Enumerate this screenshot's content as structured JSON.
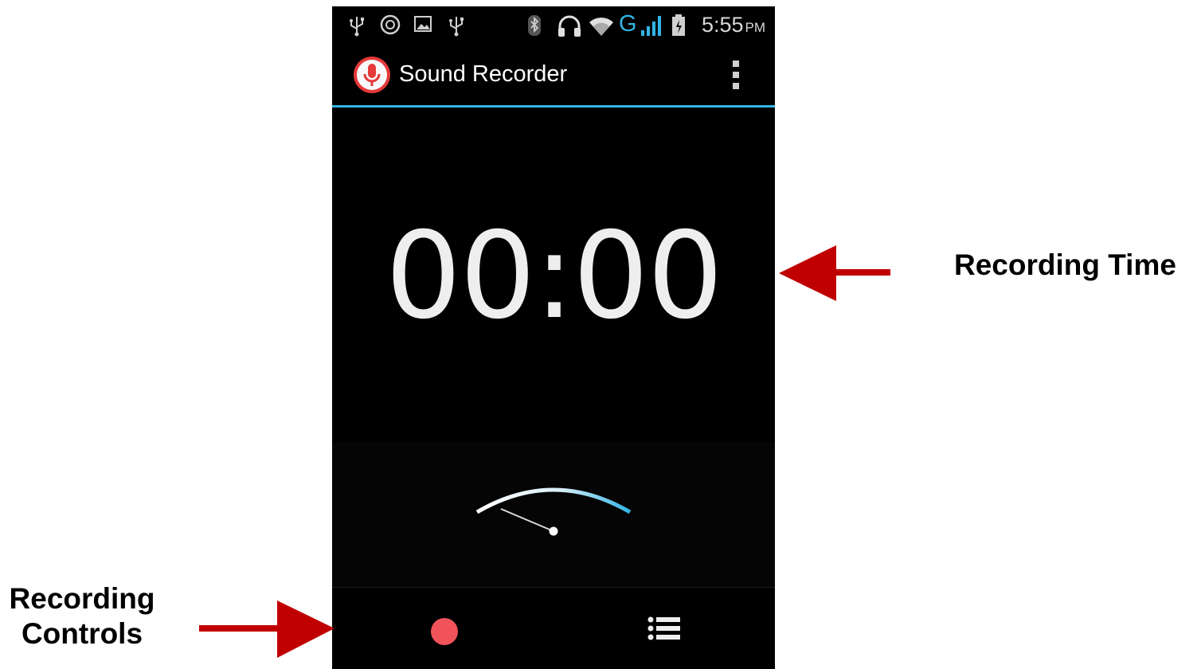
{
  "status_bar": {
    "time": "5:55",
    "ampm": "PM",
    "network_type": "G",
    "icons": [
      "usb-icon",
      "sync-icon",
      "image-icon",
      "usb-icon",
      "bluetooth-icon",
      "headset-icon",
      "wifi-icon",
      "signal-icon",
      "battery-icon"
    ]
  },
  "app": {
    "title": "Sound Recorder",
    "icon": "microphone-icon",
    "menu_icon": "overflow-menu-icon"
  },
  "recorder": {
    "elapsed_time": "00:00",
    "record_icon": "record-icon",
    "list_icon": "list-icon"
  },
  "annotations": {
    "time_label": "Recording Time",
    "controls_label_line1": "Recording",
    "controls_label_line2": "Controls"
  },
  "colors": {
    "accent": "#33b5e5",
    "record": "#f1535a",
    "arrow": "#c00000",
    "app_icon": "#e5393a"
  }
}
